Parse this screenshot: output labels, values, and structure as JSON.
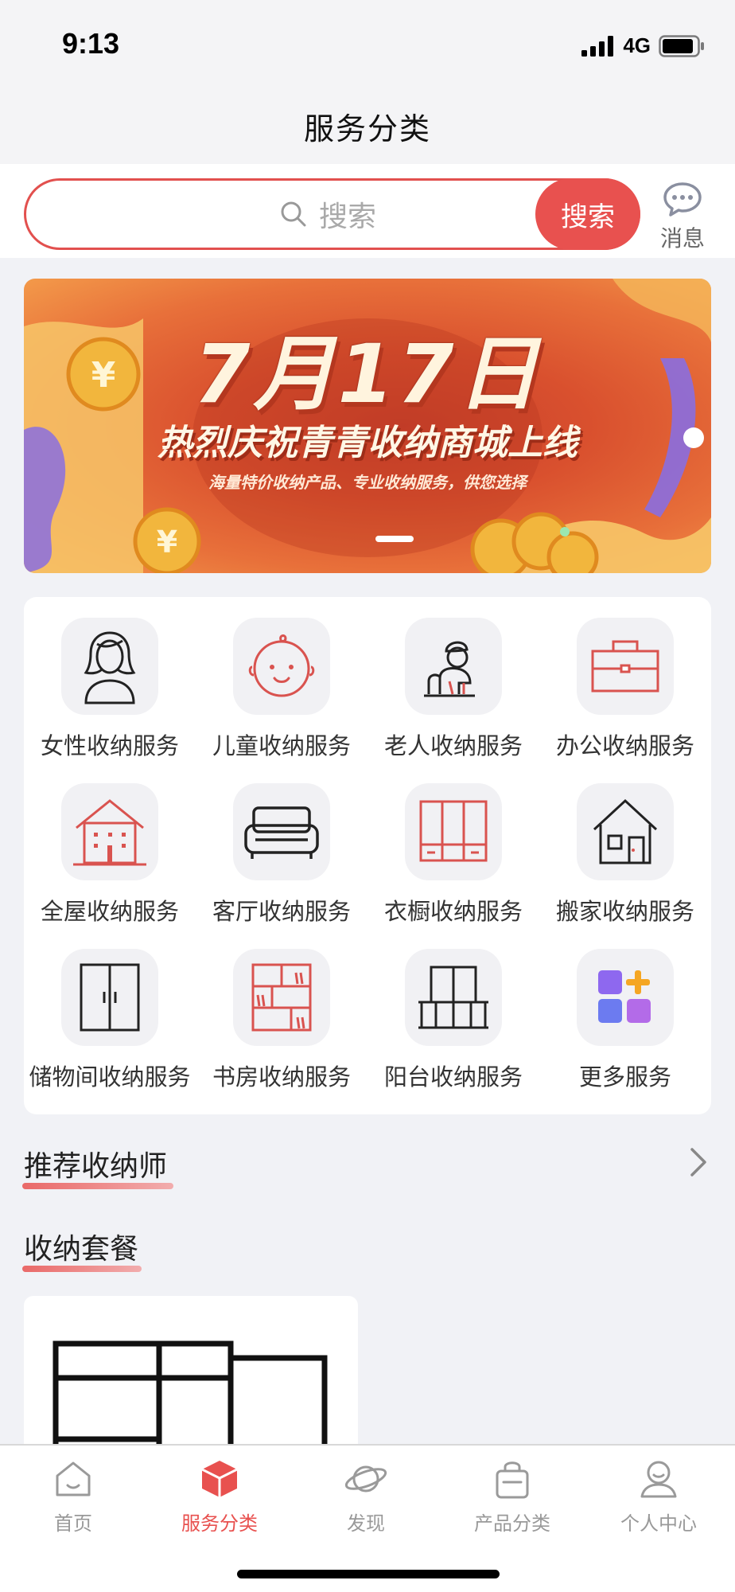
{
  "status_bar": {
    "time": "9:13",
    "network": "4G"
  },
  "nav": {
    "title": "服务分类"
  },
  "search": {
    "placeholder": "搜索",
    "button_label": "搜索",
    "message_label": "消息"
  },
  "banner": {
    "date": "7月17日",
    "headline": "热烈庆祝青青收纳商城上线",
    "subtitle": "海量特价收纳产品、专业收纳服务，供您选择"
  },
  "services": [
    {
      "label": "女性收纳服务",
      "icon": "woman-icon"
    },
    {
      "label": "儿童收纳服务",
      "icon": "child-face-icon"
    },
    {
      "label": "老人收纳服务",
      "icon": "elderly-icon"
    },
    {
      "label": "办公收纳服务",
      "icon": "briefcase-icon"
    },
    {
      "label": "全屋收纳服务",
      "icon": "house-building-icon"
    },
    {
      "label": "客厅收纳服务",
      "icon": "sofa-icon"
    },
    {
      "label": "衣橱收纳服务",
      "icon": "wardrobe-icon"
    },
    {
      "label": "搬家收纳服务",
      "icon": "home-icon"
    },
    {
      "label": "储物间收纳服务",
      "icon": "double-door-cabinet-icon"
    },
    {
      "label": "书房收纳服务",
      "icon": "bookshelf-icon"
    },
    {
      "label": "阳台收纳服务",
      "icon": "balcony-icon"
    },
    {
      "label": "更多服务",
      "icon": "more-blocks-icon"
    }
  ],
  "sections": {
    "recommended": "推荐收纳师",
    "packages": "收纳套餐"
  },
  "tabs": [
    {
      "label": "首页",
      "icon": "home-tab-icon",
      "active": false
    },
    {
      "label": "服务分类",
      "icon": "cube-tab-icon",
      "active": true
    },
    {
      "label": "发现",
      "icon": "planet-tab-icon",
      "active": false
    },
    {
      "label": "产品分类",
      "icon": "bag-tab-icon",
      "active": false
    },
    {
      "label": "个人中心",
      "icon": "user-tab-icon",
      "active": false
    }
  ],
  "colors": {
    "accent": "#e8514f",
    "inactive_tab": "#999999",
    "background": "#f1f2f6"
  }
}
